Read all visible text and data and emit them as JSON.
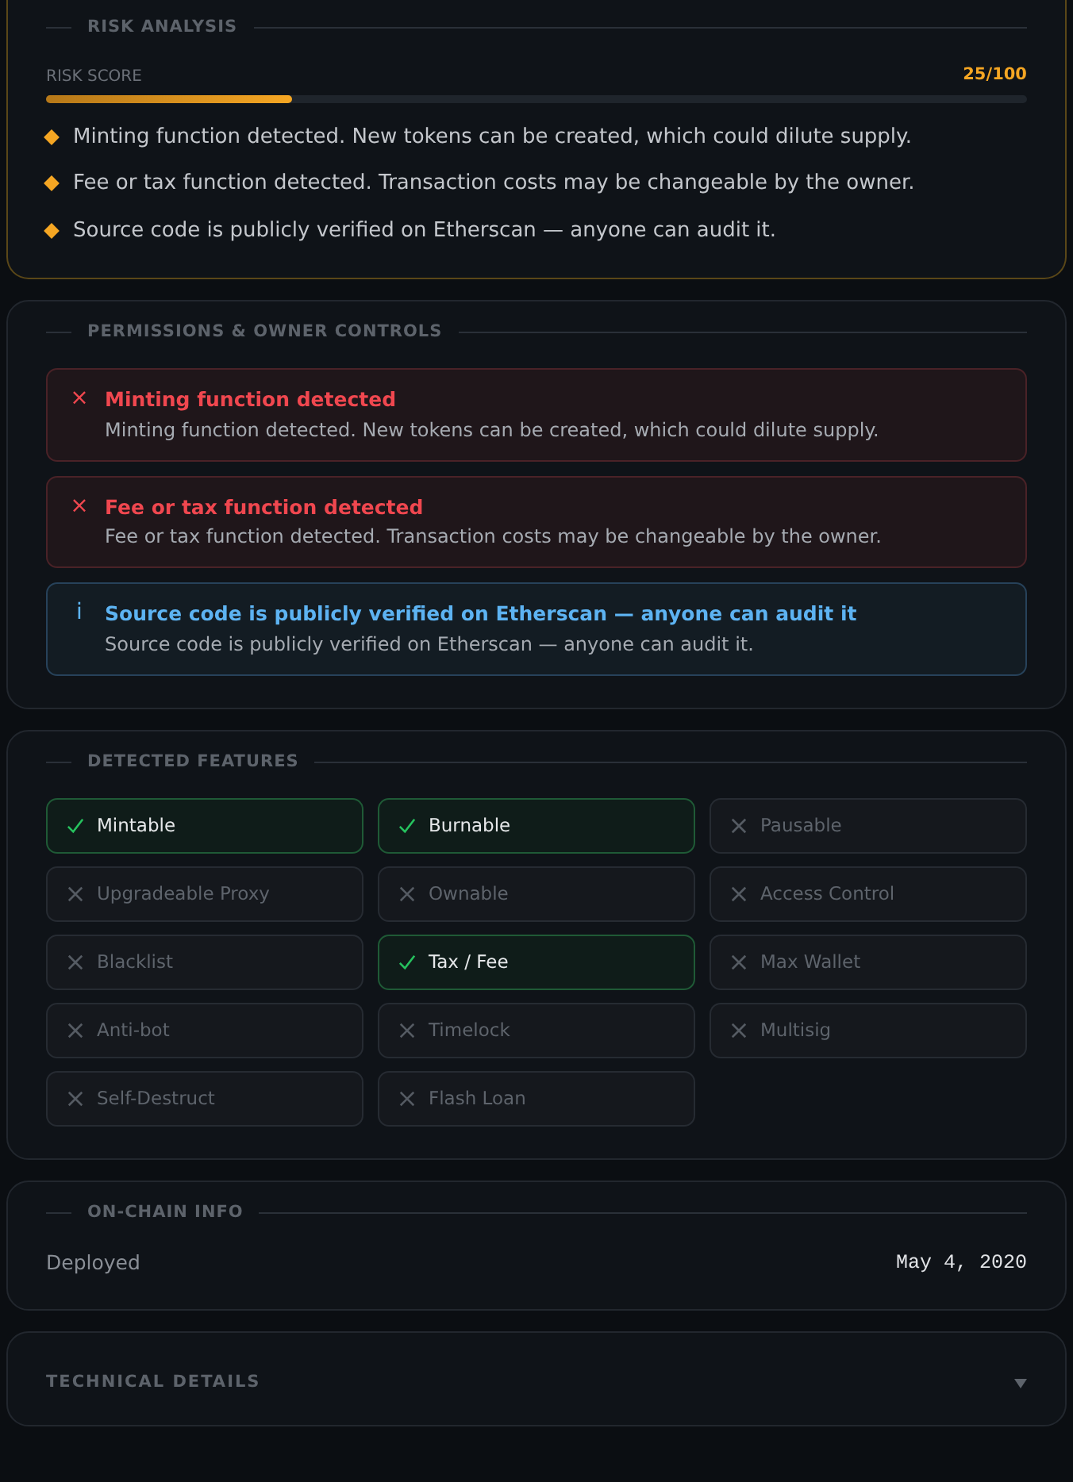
{
  "risk_analysis": {
    "title": "RISK ANALYSIS",
    "score_label": "RISK SCORE",
    "score_text": "25/100",
    "level": 0.25,
    "notes": [
      "Minting function detected. New tokens can be created, which could dilute supply.",
      "Fee or tax function detected. Transaction costs may be changeable by the owner.",
      "Source code is publicly verified on Etherscan — anyone can audit it."
    ]
  },
  "permissions": {
    "title": "PERMISSIONS & OWNER CONTROLS",
    "alerts": [
      {
        "kind": "danger",
        "icon": "×",
        "title": "Minting function detected",
        "text": "Minting function detected. New tokens can be created, which could dilute supply."
      },
      {
        "kind": "danger",
        "icon": "×",
        "title": "Fee or tax function detected",
        "text": "Fee or tax function detected. Transaction costs may be changeable by the owner."
      },
      {
        "kind": "info",
        "icon": "i",
        "title": "Source code is publicly verified on Etherscan — anyone can audit it",
        "text": "Source code is publicly verified on Etherscan — anyone can audit it."
      }
    ]
  },
  "features": {
    "title": "DETECTED FEATURES",
    "items": [
      {
        "label": "Mintable",
        "detected": true
      },
      {
        "label": "Burnable",
        "detected": true
      },
      {
        "label": "Pausable",
        "detected": false
      },
      {
        "label": "Upgradeable Proxy",
        "detected": false
      },
      {
        "label": "Ownable",
        "detected": false
      },
      {
        "label": "Access Control",
        "detected": false
      },
      {
        "label": "Blacklist",
        "detected": false
      },
      {
        "label": "Tax / Fee",
        "detected": true
      },
      {
        "label": "Max Wallet",
        "detected": false
      },
      {
        "label": "Anti-bot",
        "detected": false
      },
      {
        "label": "Timelock",
        "detected": false
      },
      {
        "label": "Multisig",
        "detected": false
      },
      {
        "label": "Self-Destruct",
        "detected": false
      },
      {
        "label": "Flash Loan",
        "detected": false
      }
    ]
  },
  "on_chain": {
    "title": "ON-CHAIN INFO",
    "rows": [
      {
        "label": "Deployed",
        "value": "May 4, 2020"
      }
    ]
  },
  "technical_details": {
    "title": "TECHNICAL DETAILS",
    "expanded": false
  }
}
